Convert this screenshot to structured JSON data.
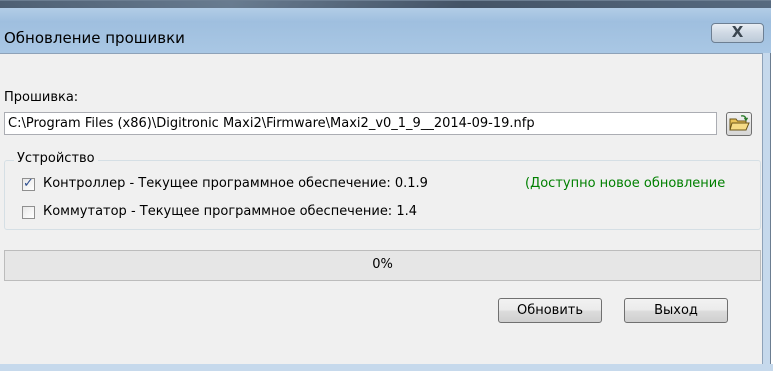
{
  "window": {
    "title": "Обновление прошивки",
    "close_glyph": "X"
  },
  "firmware": {
    "label": "Прошивка:",
    "path": "C:\\Program Files (x86)\\Digitronic Maxi2\\Firmware\\Maxi2_v0_1_9__2014-09-19.nfp",
    "browse_icon": "open-folder-icon"
  },
  "device": {
    "legend": "Устройство",
    "controller": {
      "checked": true,
      "label": "Контроллер  - Текущее программное обеспечение: 0.1.9",
      "update_note": "(Доступно новое обновление"
    },
    "switch": {
      "checked": false,
      "label": "Коммутатор - Текущее программное обеспечение: 1.4"
    }
  },
  "progress": {
    "value": 0,
    "text": "0%",
    "fill_color": "#06b025"
  },
  "buttons": {
    "update": "Обновить",
    "exit": "Выход"
  },
  "colors": {
    "update_note": "#008000",
    "frame": "#c6d9ec"
  }
}
